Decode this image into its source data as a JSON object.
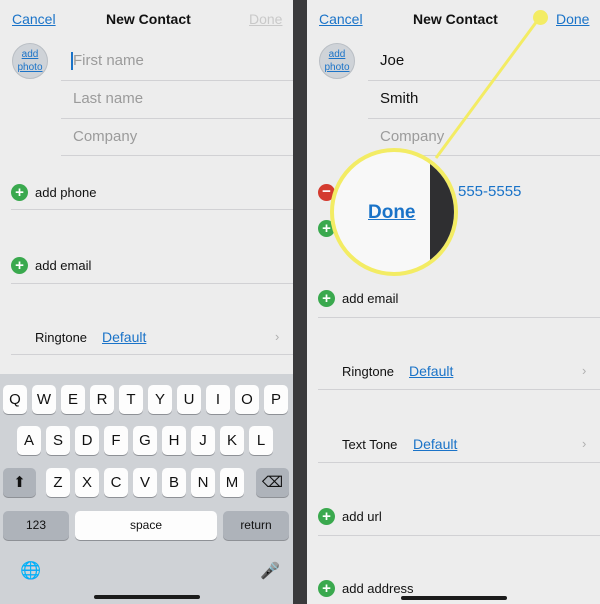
{
  "left": {
    "nav": {
      "cancel": "Cancel",
      "title": "New Contact",
      "done": "Done"
    },
    "avatar": {
      "line1": "add",
      "line2": "photo"
    },
    "fields": {
      "first_name_placeholder": "First name",
      "last_name_placeholder": "Last name",
      "company_placeholder": "Company"
    },
    "add_phone": "add phone",
    "add_email": "add email",
    "ringtone": {
      "label": "Ringtone",
      "value": "Default"
    },
    "keyboard": {
      "row1": [
        "Q",
        "W",
        "E",
        "R",
        "T",
        "Y",
        "U",
        "I",
        "O",
        "P"
      ],
      "row2": [
        "A",
        "S",
        "D",
        "F",
        "G",
        "H",
        "J",
        "K",
        "L"
      ],
      "row3": [
        "Z",
        "X",
        "C",
        "V",
        "B",
        "N",
        "M"
      ],
      "shift": "⬆",
      "backspace": "⌫",
      "numbers": "123",
      "space": "space",
      "return": "return",
      "globe": "🌐",
      "mic": "🎤"
    }
  },
  "right": {
    "nav": {
      "cancel": "Cancel",
      "title": "New Contact",
      "done": "Done"
    },
    "avatar": {
      "line1": "add",
      "line2": "photo"
    },
    "fields": {
      "first_name": "Joe",
      "last_name": "Smith",
      "company_placeholder": "Company"
    },
    "phone_partial": "555-5555",
    "add_email": "add email",
    "ringtone": {
      "label": "Ringtone",
      "value": "Default"
    },
    "text_tone": {
      "label": "Text Tone",
      "value": "Default"
    },
    "add_url": "add url",
    "add_address": "add address",
    "magnifier_text": "Done"
  },
  "colors": {
    "highlight": "#f3ec64",
    "link": "#1a73c8",
    "add_green": "#3aa94e",
    "remove_red": "#d43b2f"
  }
}
